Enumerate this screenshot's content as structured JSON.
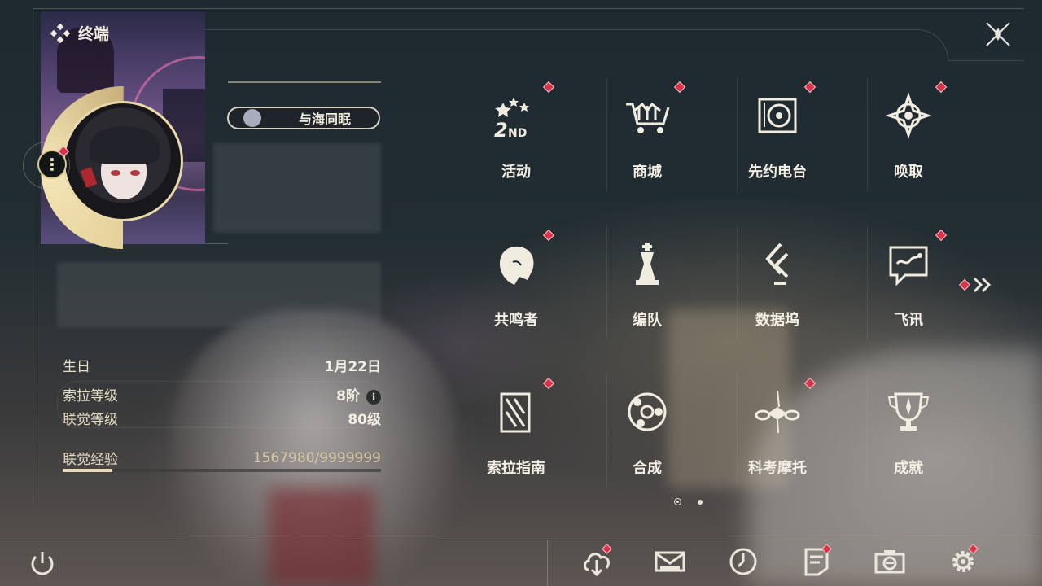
{
  "header": {
    "title": "终端",
    "close_icon": "close-icon"
  },
  "profile": {
    "tag_name": "与海同眠",
    "birthday_label": "生日",
    "birthday_value": "1月22日",
    "sola_level_label": "索拉等级",
    "sola_level_value": "8阶",
    "union_level_label": "联觉等级",
    "union_level_value": "80级",
    "union_exp_label": "联觉经验",
    "union_exp_value": "1567980/9999999",
    "union_exp_fraction": 0.157,
    "info_icon_glyph": "i",
    "menu_glyph": "⋮"
  },
  "menu": {
    "items": [
      {
        "label": "活动",
        "icon": "event-2nd-anniversary-icon",
        "badge": true
      },
      {
        "label": "商城",
        "icon": "shop-cart-icon",
        "badge": true
      },
      {
        "label": "先约电台",
        "icon": "radio-record-icon",
        "badge": true
      },
      {
        "label": "唤取",
        "icon": "convene-star-icon",
        "badge": true
      },
      {
        "label": "共鸣者",
        "icon": "resonator-portrait-icon",
        "badge": true
      },
      {
        "label": "编队",
        "icon": "team-chess-icon",
        "badge": false
      },
      {
        "label": "数据坞",
        "icon": "data-bank-icon",
        "badge": false
      },
      {
        "label": "飞讯",
        "icon": "message-chat-icon",
        "badge": true
      },
      {
        "label": "索拉指南",
        "icon": "guidebook-icon",
        "badge": true
      },
      {
        "label": "合成",
        "icon": "synthesis-icon",
        "badge": false
      },
      {
        "label": "科考摩托",
        "icon": "motorbike-icon",
        "badge": true
      },
      {
        "label": "成就",
        "icon": "trophy-icon",
        "badge": false
      }
    ],
    "page_current": 1,
    "page_total": 2
  },
  "bottom_bar": {
    "buttons": [
      {
        "name": "download",
        "icon": "cloud-download-icon",
        "badge": true
      },
      {
        "name": "mail",
        "icon": "mail-icon",
        "badge": false
      },
      {
        "name": "clock",
        "icon": "clock-icon",
        "badge": false
      },
      {
        "name": "notice",
        "icon": "notice-icon",
        "badge": true
      },
      {
        "name": "camera",
        "icon": "camera-icon",
        "badge": false
      },
      {
        "name": "settings",
        "icon": "settings-gear-icon",
        "badge": true
      }
    ]
  },
  "colors": {
    "badge": "#d9334a",
    "gold": "#e5d19a",
    "text": "#f4efe4"
  }
}
